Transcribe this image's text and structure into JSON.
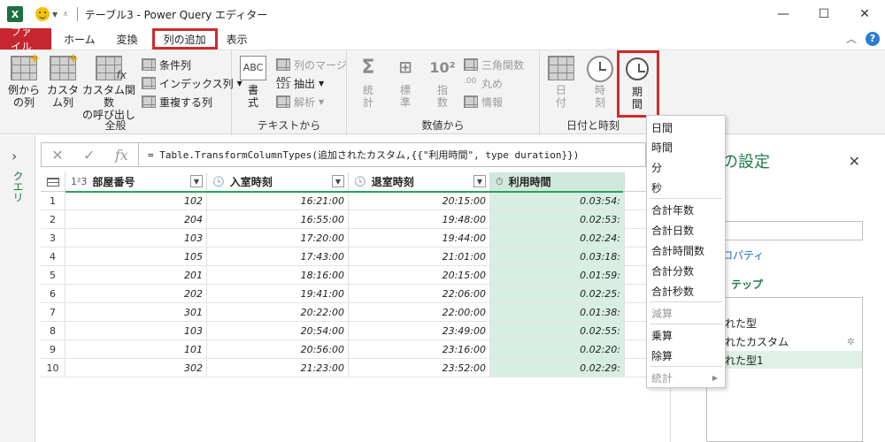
{
  "window": {
    "app_logo": "X",
    "title": "テーブル3 - Power Query エディター",
    "minimize": "—",
    "maximize": "☐",
    "close": "✕"
  },
  "tabs": {
    "file": "ファイル",
    "home": "ホーム",
    "transform": "変換",
    "add_column": "列の追加",
    "view": "表示"
  },
  "ribbon": {
    "general": {
      "label": "全般",
      "column_from_examples": "例から\nの列",
      "custom_column": "カスタ\nム列",
      "invoke_custom_function": "カスタム関数\nの呼び出し",
      "conditional_column": "条件列",
      "index_column": "インデックス列",
      "duplicate_column": "重複する列"
    },
    "text": {
      "label": "テキストから",
      "format": "書\n式",
      "merge_columns": "列のマージ",
      "extract": "抽出",
      "parse": "解析"
    },
    "number": {
      "label": "数値から",
      "statistics": "統\n計",
      "standard": "標\n準",
      "scientific": "指\n数",
      "trigonometry": "三角関数",
      "rounding": "丸め",
      "information": "情報"
    },
    "datetime": {
      "label": "日付と時刻",
      "date": "日\n付",
      "time": "時\n刻",
      "duration": "期\n間"
    }
  },
  "rail": {
    "label": "クエリ"
  },
  "formula_bar": {
    "fx": "fx",
    "formula": "= Table.TransformColumnTypes(追加されたカスタム,{{\"利用時間\", type duration}})"
  },
  "grid": {
    "headers": [
      {
        "type_icon": "1²3",
        "name": "部屋番号"
      },
      {
        "type_icon": "🕓",
        "name": "入室時刻"
      },
      {
        "type_icon": "🕓",
        "name": "退室時刻"
      },
      {
        "type_icon": "⏱",
        "name": "利用時間"
      }
    ],
    "rows": [
      {
        "n": "1",
        "room": "102",
        "in": "16:21:00",
        "out": "20:15:00",
        "dur": "0.03:54:"
      },
      {
        "n": "2",
        "room": "204",
        "in": "16:55:00",
        "out": "19:48:00",
        "dur": "0.02:53:"
      },
      {
        "n": "3",
        "room": "103",
        "in": "17:20:00",
        "out": "19:44:00",
        "dur": "0.02:24:"
      },
      {
        "n": "4",
        "room": "105",
        "in": "17:43:00",
        "out": "21:01:00",
        "dur": "0.03:18:"
      },
      {
        "n": "5",
        "room": "201",
        "in": "18:16:00",
        "out": "20:15:00",
        "dur": "0.01:59:"
      },
      {
        "n": "6",
        "room": "202",
        "in": "19:41:00",
        "out": "22:06:00",
        "dur": "0.02:25:"
      },
      {
        "n": "7",
        "room": "301",
        "in": "20:22:00",
        "out": "22:00:00",
        "dur": "0.01:38:"
      },
      {
        "n": "8",
        "room": "103",
        "in": "20:54:00",
        "out": "23:49:00",
        "dur": "0.02:55:"
      },
      {
        "n": "9",
        "room": "101",
        "in": "20:56:00",
        "out": "23:16:00",
        "dur": "0.02:20:"
      },
      {
        "n": "10",
        "room": "302",
        "in": "21:23:00",
        "out": "23:52:00",
        "dur": "0.02:29:"
      }
    ]
  },
  "settings_pane": {
    "title": "の設定",
    "properties_link": "ロパティ",
    "steps_title": "テップ",
    "steps": [
      "れた型",
      "れたカスタム",
      "れた型1"
    ]
  },
  "duration_menu": {
    "items": [
      "日間",
      "時間",
      "分",
      "秒",
      "合計年数",
      "合計日数",
      "合計時間数",
      "合計分数",
      "合計秒数",
      "減算",
      "乗算",
      "除算",
      "統計"
    ]
  }
}
